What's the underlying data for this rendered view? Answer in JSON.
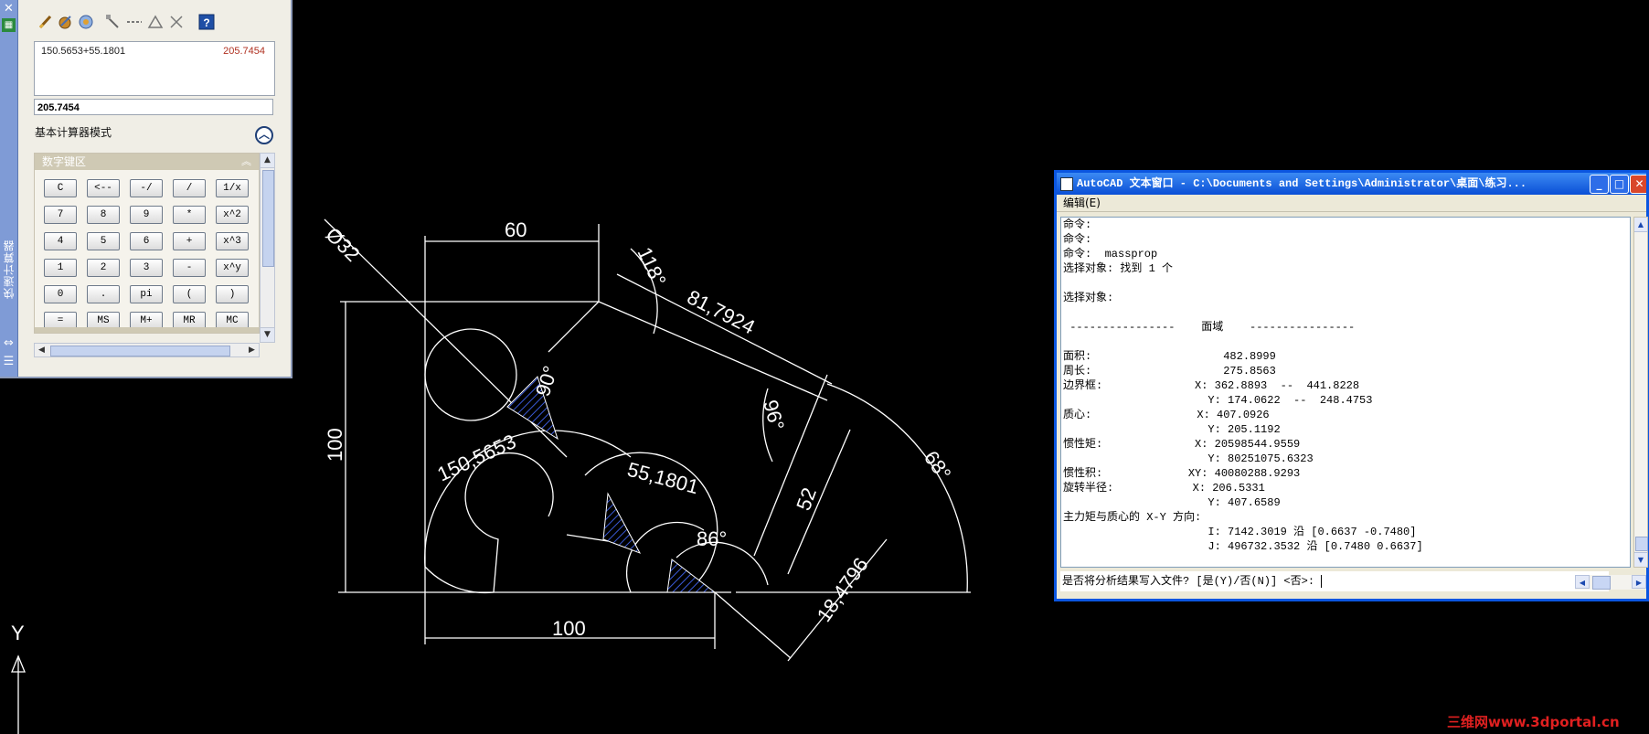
{
  "calculator": {
    "palette_title": "快速计算器",
    "history": {
      "expression": "150.5653+55.1801",
      "result": "205.7454"
    },
    "input_value": "205.7454",
    "mode_label": "基本计算器模式",
    "keypad_title": "数字键区",
    "keys": [
      "C",
      "<--",
      "-/",
      "/",
      "1/x",
      "7",
      "8",
      "9",
      "*",
      "x^2",
      "4",
      "5",
      "6",
      "+",
      "x^3",
      "1",
      "2",
      "3",
      "-",
      "x^y",
      "0",
      ".",
      "pi",
      "(",
      ")",
      "=",
      "MS",
      "M+",
      "MR",
      "MC"
    ],
    "tools": [
      "clear-icon",
      "clear-history-icon",
      "get-coordinates-icon",
      "distance-icon",
      "angle-icon",
      "intersection-icon",
      "help-icon"
    ]
  },
  "drawing": {
    "dimensions": {
      "diameter": "Ø32",
      "top_width": "60",
      "angle_top": "118°",
      "slant_length": "81,7924",
      "height_left": "100",
      "angle_90": "90°",
      "angle_96": "96°",
      "radius_left": "150,5653",
      "radius_mid": "55,1801",
      "dim_52": "52",
      "angle_68": "68°",
      "angle_86": "86°",
      "dim_18": "18,4796",
      "bottom_width": "100"
    },
    "ucs_label": "Y"
  },
  "text_window": {
    "title": "AutoCAD 文本窗口 - C:\\Documents and Settings\\Administrator\\桌面\\练习...",
    "menu_edit": "编辑(E)",
    "lines": [
      "命令:",
      "命令:",
      "命令:  massprop",
      "选择对象: 找到 1 个",
      "",
      "选择对象:",
      "",
      " ----------------    面域    ----------------",
      "",
      "面积:                    482.8999",
      "周长:                    275.8563",
      "边界框:              X: 362.8893  --  441.8228",
      "                      Y: 174.0622  --  248.4753",
      "质心:                X: 407.0926",
      "                      Y: 205.1192",
      "惯性矩:              X: 20598544.9559",
      "                      Y: 80251075.6323",
      "惯性积:             XY: 40080288.9293",
      "旋转半径:            X: 206.5331",
      "                      Y: 407.6589",
      "主力矩与质心的 X-Y 方向:",
      "                      I: 7142.3019 沿 [0.6637 -0.7480]",
      "                      J: 496732.3532 沿 [0.7480 0.6637]"
    ],
    "prompt": "是否将分析结果写入文件? [是(Y)/否(N)] <否>: "
  },
  "watermark": "三维网www.3dportal.cn",
  "colors": {
    "drawing_bg": "#000000",
    "hatch": "#2a3fa8",
    "titlebar": "#0a55e0"
  }
}
